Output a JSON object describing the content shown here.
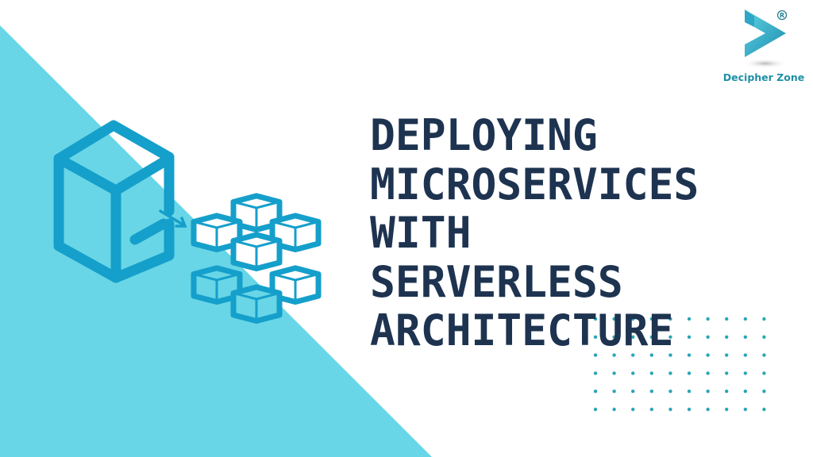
{
  "slide": {
    "title_lines": [
      "DEPLOYING",
      "MICROSERVICES",
      "WITH",
      "SERVERLESS",
      "ARCHITECTURE"
    ],
    "colors": {
      "background": "#ffffff",
      "triangle": "#68d6e6",
      "icon_stroke": "#159fcb",
      "title": "#1d3350",
      "dots": "#2aa5b8"
    }
  },
  "logo": {
    "brand_name": "Decipher Zone",
    "registered_mark": "®",
    "icon": "play-triangle-logo-icon"
  },
  "illustration": {
    "icon_left": "single-cube-icon",
    "arrow": "arrow-right-icon",
    "icon_right": "cube-cluster-icon"
  }
}
